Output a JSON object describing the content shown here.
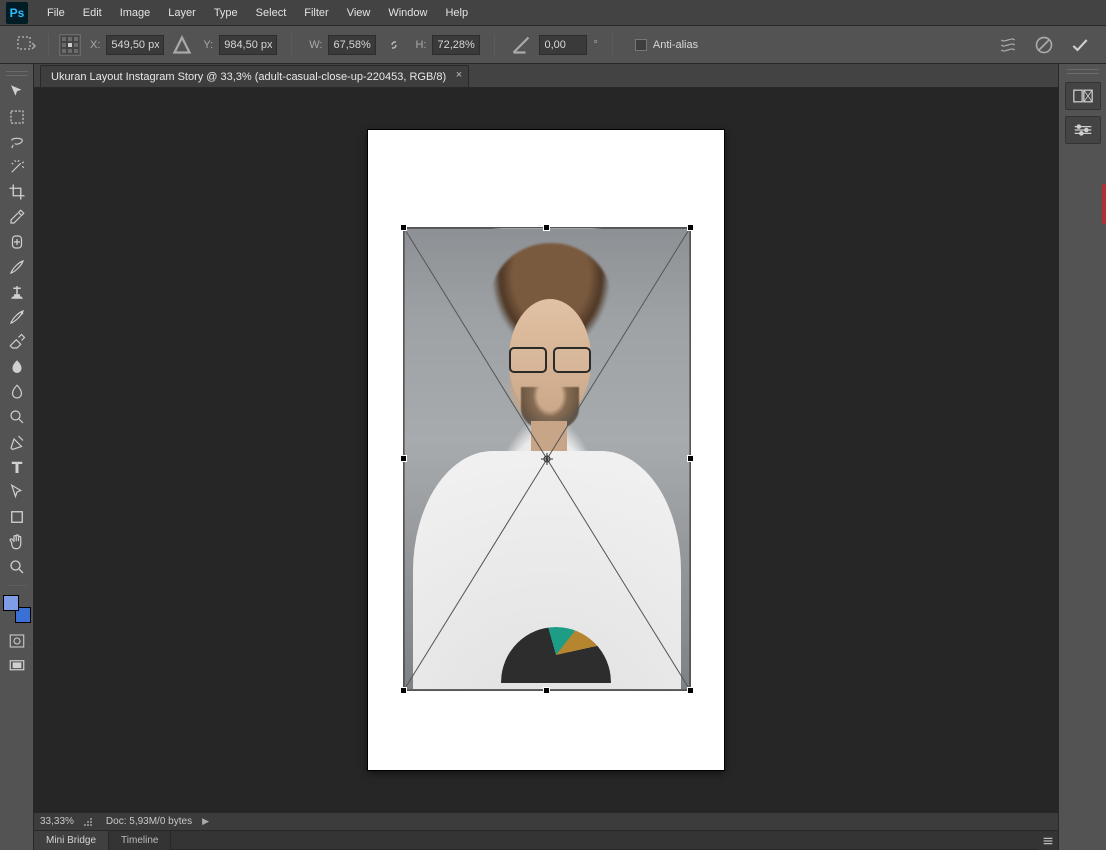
{
  "menu": {
    "items": [
      "File",
      "Edit",
      "Image",
      "Layer",
      "Type",
      "Select",
      "Filter",
      "View",
      "Window",
      "Help"
    ]
  },
  "options": {
    "x_label": "X:",
    "x": "549,50 px",
    "y_label": "Y:",
    "y": "984,50 px",
    "w_label": "W:",
    "w": "67,58%",
    "h_label": "H:",
    "h": "72,28%",
    "angle": "0,00",
    "antialias_label": "Anti-alias"
  },
  "doc": {
    "tab_title": "Ukuran Layout Instagram Story @ 33,3% (adult-casual-close-up-220453, RGB/8)"
  },
  "status": {
    "zoom": "33,33%",
    "doc_info": "Doc: 5,93M/0 bytes"
  },
  "bottom_tabs": {
    "a": "Mini Bridge",
    "b": "Timeline"
  }
}
